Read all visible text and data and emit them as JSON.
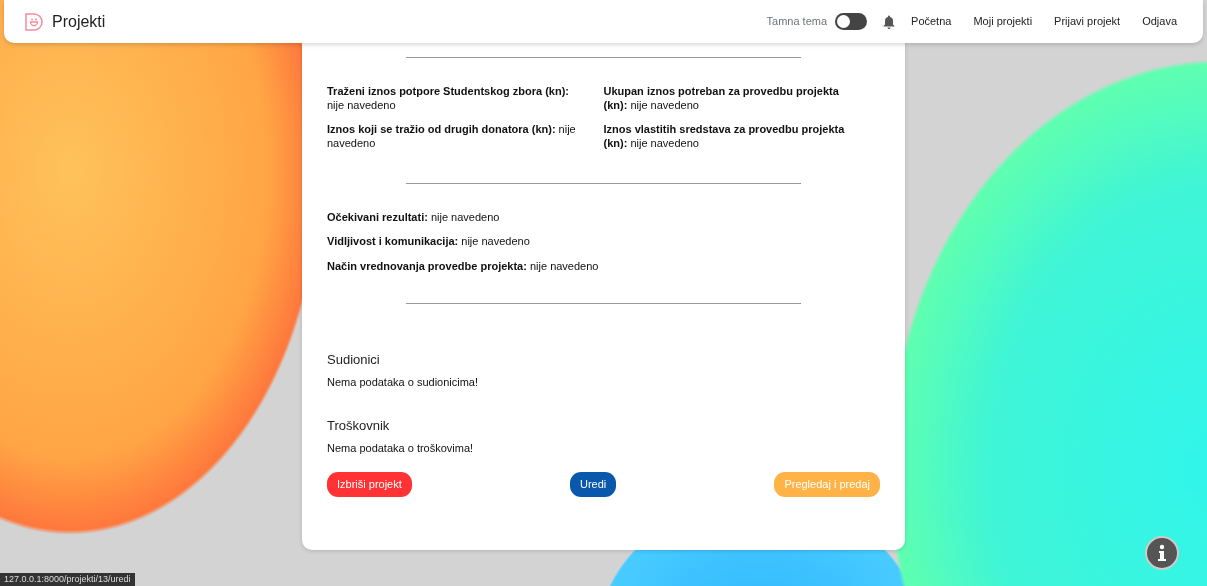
{
  "navbar": {
    "brand": "Projekti",
    "theme_toggle": {
      "label": "Tamna tema",
      "on": false
    },
    "links": [
      {
        "label": "Početna"
      },
      {
        "label": "Moji projekti"
      },
      {
        "label": "Prijavi projekt"
      },
      {
        "label": "Odjava"
      }
    ]
  },
  "sections": [
    {
      "kind": "grid",
      "fields": [
        {
          "label": "Traženi iznos potpore Studentskog zbora (kn):",
          "value": "nije navedeno"
        },
        {
          "label": "Ukupan iznos potreban za provedbu projekta (kn):",
          "value": "nije navedeno"
        },
        {
          "label": "Iznos koji se tražio od drugih donatora (kn):",
          "value": "nije navedeno"
        },
        {
          "label": "Iznos vlastitih sredstava za provedbu projekta (kn):",
          "value": "nije navedeno"
        }
      ]
    },
    {
      "kind": "list",
      "fields": [
        {
          "label": "Očekivani rezultati:",
          "value": "nije navedeno"
        },
        {
          "label": "Vidljivost i komunikacija:",
          "value": "nije navedeno"
        },
        {
          "label": "Način vrednovanja provedbe projekta:",
          "value": "nije navedeno"
        }
      ]
    },
    {
      "kind": "blocks",
      "blocks": [
        {
          "title": "Sudionici",
          "text": "Nema podataka o sudionicima!"
        },
        {
          "title": "Troškovnik",
          "text": "Nema podataka o troškovima!"
        }
      ]
    }
  ],
  "buttons": [
    {
      "label": "Izbriši projekt",
      "kind": "danger"
    },
    {
      "label": "Uredi",
      "kind": "primary"
    },
    {
      "label": "Pregledaj i predaj",
      "kind": "warning"
    }
  ],
  "status_url": "127.0.0.1:8000/projekti/13/uredi"
}
